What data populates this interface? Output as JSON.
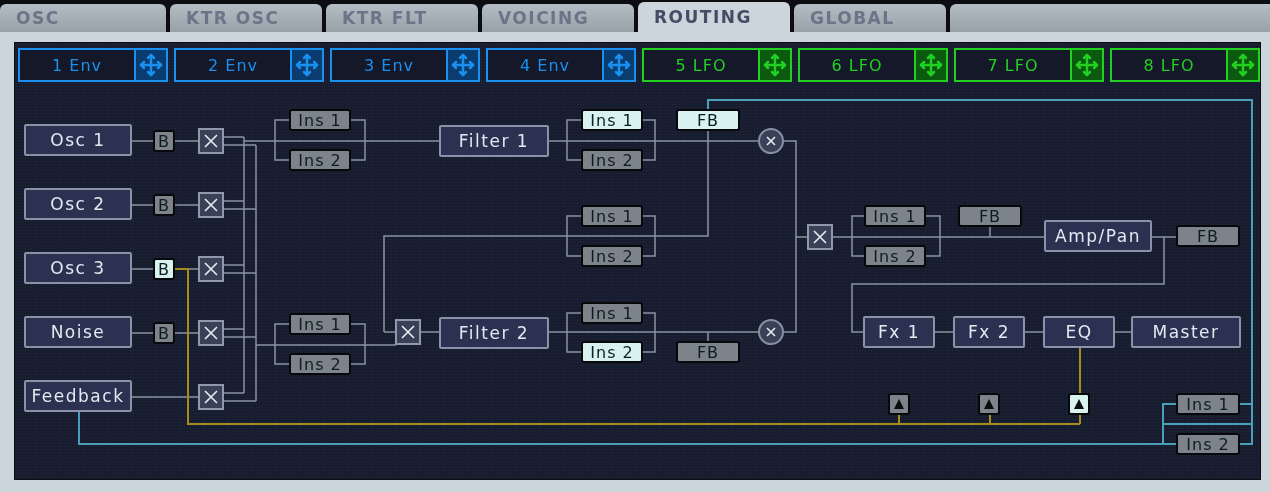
{
  "tabs": [
    {
      "label": "OSC",
      "selected": false
    },
    {
      "label": "KTR OSC",
      "selected": false
    },
    {
      "label": "KTR FLT",
      "selected": false
    },
    {
      "label": "VOICING",
      "selected": false
    },
    {
      "label": "ROUTING",
      "selected": true
    },
    {
      "label": "GLOBAL",
      "selected": false
    }
  ],
  "modulators": [
    {
      "label": "1 Env",
      "kind": "env"
    },
    {
      "label": "2 Env",
      "kind": "env"
    },
    {
      "label": "3 Env",
      "kind": "env"
    },
    {
      "label": "4 Env",
      "kind": "env"
    },
    {
      "label": "5 LFO",
      "kind": "lfo"
    },
    {
      "label": "6 LFO",
      "kind": "lfo"
    },
    {
      "label": "7 LFO",
      "kind": "lfo"
    },
    {
      "label": "8 LFO",
      "kind": "lfo"
    }
  ],
  "sources": [
    {
      "label": "Osc 1"
    },
    {
      "label": "Osc 2"
    },
    {
      "label": "Osc 3"
    },
    {
      "label": "Noise"
    },
    {
      "label": "Feedback"
    }
  ],
  "source_bypass": [
    {
      "label": "B",
      "selected": false
    },
    {
      "label": "B",
      "selected": false
    },
    {
      "label": "B",
      "selected": true
    },
    {
      "label": "B",
      "selected": false
    }
  ],
  "pre_filter_inserts": [
    {
      "label": "Ins 1",
      "selected": false
    },
    {
      "label": "Ins 2",
      "selected": false
    },
    {
      "label": "Ins 1",
      "selected": false
    },
    {
      "label": "Ins 2",
      "selected": false
    }
  ],
  "filters": [
    {
      "label": "Filter 1"
    },
    {
      "label": "Filter 2"
    }
  ],
  "filter_inserts": [
    {
      "label": "Ins 1",
      "selected": true
    },
    {
      "label": "Ins 2",
      "selected": false
    },
    {
      "label": "Ins 1",
      "selected": false
    },
    {
      "label": "Ins 2",
      "selected": false
    },
    {
      "label": "Ins 1",
      "selected": false
    },
    {
      "label": "Ins 2",
      "selected": true
    }
  ],
  "filter_feedback": [
    {
      "label": "FB",
      "selected": true
    },
    {
      "label": "FB",
      "selected": false
    }
  ],
  "amp_inserts": [
    {
      "label": "Ins 1",
      "selected": false
    },
    {
      "label": "Ins 2",
      "selected": false
    }
  ],
  "amp_feedback": [
    {
      "label": "FB",
      "selected": false
    },
    {
      "label": "FB",
      "selected": false
    }
  ],
  "amp": {
    "label": "Amp/Pan"
  },
  "effects": [
    {
      "label": "Fx 1"
    },
    {
      "label": "Fx 2"
    },
    {
      "label": "EQ"
    },
    {
      "label": "Master"
    }
  ],
  "triggers": [
    {
      "selected": false
    },
    {
      "selected": false
    },
    {
      "selected": true
    }
  ],
  "master_inserts": [
    {
      "label": "Ins 1",
      "selected": false
    },
    {
      "label": "Ins 2",
      "selected": false
    }
  ]
}
